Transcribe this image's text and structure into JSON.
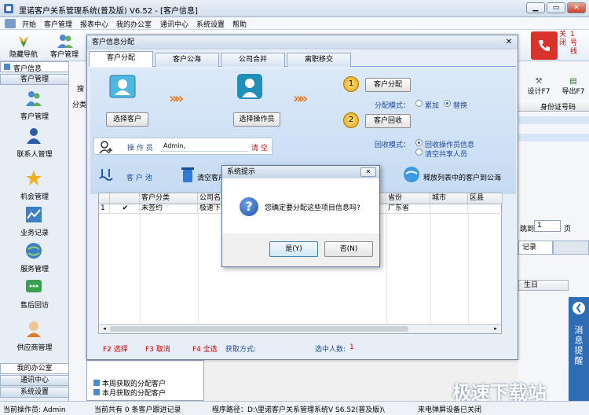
{
  "window": {
    "title": "里诺客户关系管理系统(普及版) V6.52 - [客户信息]"
  },
  "menu": [
    "开始",
    "客户管理",
    "报表中心",
    "我的办公室",
    "通讯中心",
    "系统设置",
    "帮助"
  ],
  "toolbar": {
    "nav_label": "隐藏导航",
    "customer_label": "客户管理",
    "close_label_1": "关",
    "close_label_2": "1",
    "close_label_3": "号",
    "close_label_4": "闭",
    "close_label_5": "线"
  },
  "sidebar": {
    "tab_label": "客户信息",
    "group_header": "客户管理",
    "items": [
      {
        "label": "客户管理"
      },
      {
        "label": "联系人管理"
      },
      {
        "label": "机会管理"
      },
      {
        "label": "业务记录"
      },
      {
        "label": "服务管理"
      },
      {
        "label": "售后回访"
      },
      {
        "label": "供应商管理"
      }
    ],
    "bottom": [
      "我的办公室",
      "通讯中心",
      "系统设置"
    ]
  },
  "background": {
    "search_label": "搜",
    "category_label": "分类",
    "col_id": "身份证号码",
    "set_label": "设计F7",
    "export_label": "导出F7",
    "goto_label": "跳到",
    "page_value": "1",
    "page_unit": "页",
    "record_label": "记录",
    "birthday_col": "生日",
    "side_banner": "消息提醒",
    "week_item": "本周获取的分配客户",
    "month_item": "本月获取的分配客户"
  },
  "dialog": {
    "title": "客户信息分配",
    "tabs": [
      "客户分配",
      "客户公海",
      "公司合并",
      "离职移交"
    ],
    "select_customer": "选择客户",
    "select_operator": "选择操作员",
    "step1": "1",
    "step2": "2",
    "assign_button": "客户分配",
    "reclaim_button": "客户回收",
    "assign_mode_label": "分配模式：",
    "mode_add": "累加",
    "mode_replace": "替换",
    "reclaim_mode_label": "回收模式：",
    "reclaim_opt1": "回收操作员信息",
    "reclaim_opt2": "清空共享人员",
    "operator_label": "操 作 员",
    "operator_value": "Admin,",
    "clear_label": "清 空",
    "pool_label": "客 户 池",
    "clear_customers": "清空客户",
    "release_label": "释放列表中的客户到公海",
    "grid_columns": [
      "客户分类",
      "公司名称",
      "省份",
      "城市",
      "区县"
    ],
    "grid_row": {
      "index": "1",
      "category": "未签约",
      "company": "极速下载",
      "province": "广东省"
    },
    "footer": {
      "f2": "F2 选择",
      "f3": "F3 取消",
      "f4": "F4 全选",
      "method": "获取方式:",
      "count_label": "选中人数:",
      "count": "1"
    }
  },
  "messagebox": {
    "title": "系统提示",
    "text": "您确定要分配这些项目信息吗?",
    "yes": "是(Y)",
    "no": "否(N)"
  },
  "statusbar": {
    "operator": "当前操作员: Admin",
    "records": "当前共有 0 条客户跟进记录",
    "path": "程序路径：D:\\里诺客户关系管理系统V S6.52(普及版)\\",
    "extra": "来电弹屏设备已关闭"
  },
  "watermark": "极速下载站"
}
